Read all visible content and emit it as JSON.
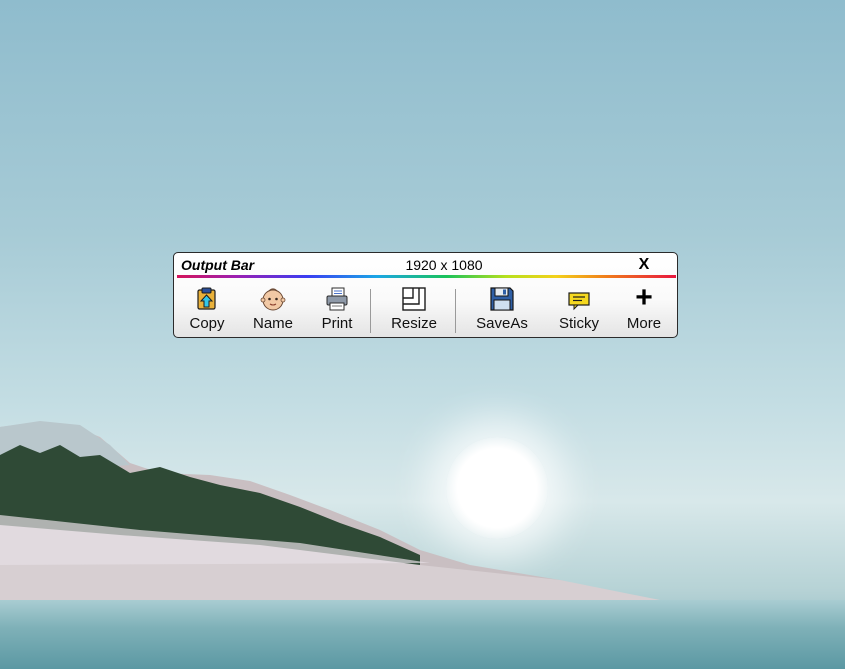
{
  "output_bar": {
    "title": "Output Bar",
    "resolution": "1920 x 1080",
    "close_label": "X",
    "tools": [
      {
        "id": "copy",
        "label": "Copy",
        "icon": "clipboard-copy-icon"
      },
      {
        "id": "name",
        "label": "Name",
        "icon": "baby-face-icon"
      },
      {
        "id": "print",
        "label": "Print",
        "icon": "printer-icon"
      },
      {
        "id": "resize",
        "label": "Resize",
        "icon": "resize-squares-icon"
      },
      {
        "id": "saveas",
        "label": "SaveAs",
        "icon": "floppy-disk-icon"
      },
      {
        "id": "sticky",
        "label": "Sticky",
        "icon": "sticky-note-icon"
      },
      {
        "id": "more",
        "label": "More",
        "icon": "plus-icon"
      }
    ]
  },
  "colors": {
    "rainbow": [
      "#d4145a",
      "#3a3cf2",
      "#19c25a",
      "#f3d11a",
      "#e8173f"
    ],
    "bar_border": "#2b2b2b"
  }
}
